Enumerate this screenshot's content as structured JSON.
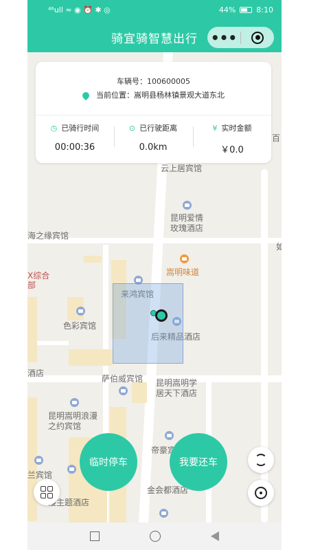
{
  "status_bar": {
    "left_icons": "⁴⁶ull ≈ ◉ ⏰ ✱ ◎",
    "battery_percent": "44%",
    "time": "8:10"
  },
  "navbar": {
    "title": "骑宜骑智慧出行",
    "menu_icon": "more-dots-icon",
    "close_icon": "target-icon"
  },
  "info_card": {
    "vehicle_no": "车辆号：10060000​5",
    "location": "当前位置：嵩明县杨林镇景观大道东北",
    "stats": [
      {
        "icon": "clock-icon",
        "label": "已骑行时间",
        "value": "00:00:36"
      },
      {
        "icon": "location-icon",
        "label": "已行驶距离",
        "value": "0.0km"
      },
      {
        "icon": "yen-icon",
        "label": "实时金额",
        "value": "￥0.0"
      }
    ]
  },
  "map": {
    "pois": [
      {
        "label": "云上居宾馆"
      },
      {
        "label": "昆明爱情\n玫瑰酒店"
      },
      {
        "label": "海之缘宾馆"
      },
      {
        "label": "嵩明味道"
      },
      {
        "label": "来鸿宾馆"
      },
      {
        "label": "色彩宾馆"
      },
      {
        "label": "后来精品酒店"
      },
      {
        "label": "萨伯威宾馆"
      },
      {
        "label": "昆明嵩明学\n居天下酒店"
      },
      {
        "label": "昆明嵩明浪漫\n之约宾馆"
      },
      {
        "label": "帝豪宾"
      },
      {
        "label": "兰宾馆"
      },
      {
        "label": "漫主题酒店"
      },
      {
        "label": "金会都酒店"
      },
      {
        "label": "酒店"
      },
      {
        "label": "X综合\n部"
      },
      {
        "label": "百"
      },
      {
        "label": "如"
      }
    ]
  },
  "buttons": {
    "temp_park": "临时停车",
    "return_bike": "我要还车"
  },
  "colors": {
    "accent": "#2dc9a6"
  }
}
